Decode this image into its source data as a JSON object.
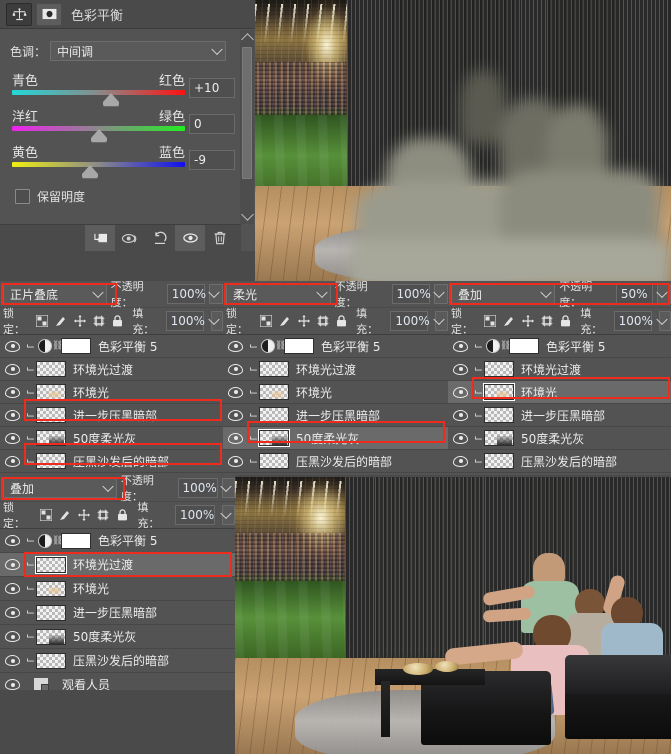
{
  "app": {
    "name": "Adobe Photoshop",
    "locale": "zh-CN"
  },
  "color_balance_panel": {
    "title": "色彩平衡",
    "icons": {
      "adjustment": "balance-scale-icon",
      "mask": "layer-mask-icon"
    },
    "tone_label": "色调：",
    "tone_value": "中间调",
    "sliders": [
      {
        "left_label": "青色",
        "right_label": "红色",
        "value": "+10",
        "knob_pct": 57
      },
      {
        "left_label": "洋红",
        "right_label": "绿色",
        "value": "0",
        "knob_pct": 50
      },
      {
        "left_label": "黄色",
        "right_label": "蓝色",
        "value": "-9",
        "knob_pct": 45
      }
    ],
    "preserve_luminosity_label": "保留明度",
    "preserve_luminosity_checked": false,
    "footer_buttons": [
      "clip-to-layer-icon",
      "toggle-preview-icon",
      "reset-icon",
      "visibility-icon",
      "delete-icon"
    ]
  },
  "layers_common": {
    "opacity_label": "不透明度：",
    "lock_label": "锁定：",
    "fill_label": "填充：",
    "lock_icons": [
      "lock-transparent-pixels-icon",
      "lock-image-pixels-icon",
      "lock-position-icon",
      "lock-artboard-icon",
      "lock-all-icon"
    ],
    "layers": [
      {
        "name": "色彩平衡 5",
        "type": "adjustment",
        "thumb": "white"
      },
      {
        "name": "环境光过渡",
        "type": "pixel",
        "thumb": "transparent"
      },
      {
        "name": "环境光",
        "type": "pixel",
        "thumb": "transparent-warm"
      },
      {
        "name": "进一步压黑暗部",
        "type": "pixel",
        "thumb": "transparent"
      },
      {
        "name": "50度柔光灰",
        "type": "pixel",
        "thumb": "transparent-gray"
      },
      {
        "name": "压黑沙发后的暗部",
        "type": "pixel",
        "thumb": "transparent"
      },
      {
        "name": "观看人员",
        "type": "smart-object",
        "thumb": "smart"
      }
    ]
  },
  "panels": [
    {
      "id": "panel-a",
      "blend_mode": "正片叠底",
      "opacity": "100%",
      "fill": "100%",
      "selected_layer_index": null,
      "highlights": [
        0,
        3,
        5
      ]
    },
    {
      "id": "panel-b",
      "blend_mode": "柔光",
      "opacity": "100%",
      "fill": "100%",
      "selected_layer_index": 4,
      "highlights": [
        0,
        4
      ]
    },
    {
      "id": "panel-c",
      "blend_mode": "叠加",
      "opacity": "50%",
      "fill": "100%",
      "selected_layer_index": 2,
      "highlights": [
        0,
        2
      ]
    },
    {
      "id": "panel-d",
      "blend_mode": "叠加",
      "opacity": "100%",
      "fill": "100%",
      "selected_layer_index": 1,
      "highlights": [
        0,
        1
      ]
    }
  ],
  "preview_top": {
    "description": "blurred composite of living room with curtains, stadium screen and viewers"
  },
  "preview_bottom": {
    "description": "living room with four men watching a stadium match on a large screen"
  },
  "colors": {
    "panel_bg": "#535353",
    "panel_dark": "#4a4a4a",
    "highlight_red": "#ef2b1d",
    "selected_row": "#6a6a6a",
    "text": "#ececec"
  }
}
